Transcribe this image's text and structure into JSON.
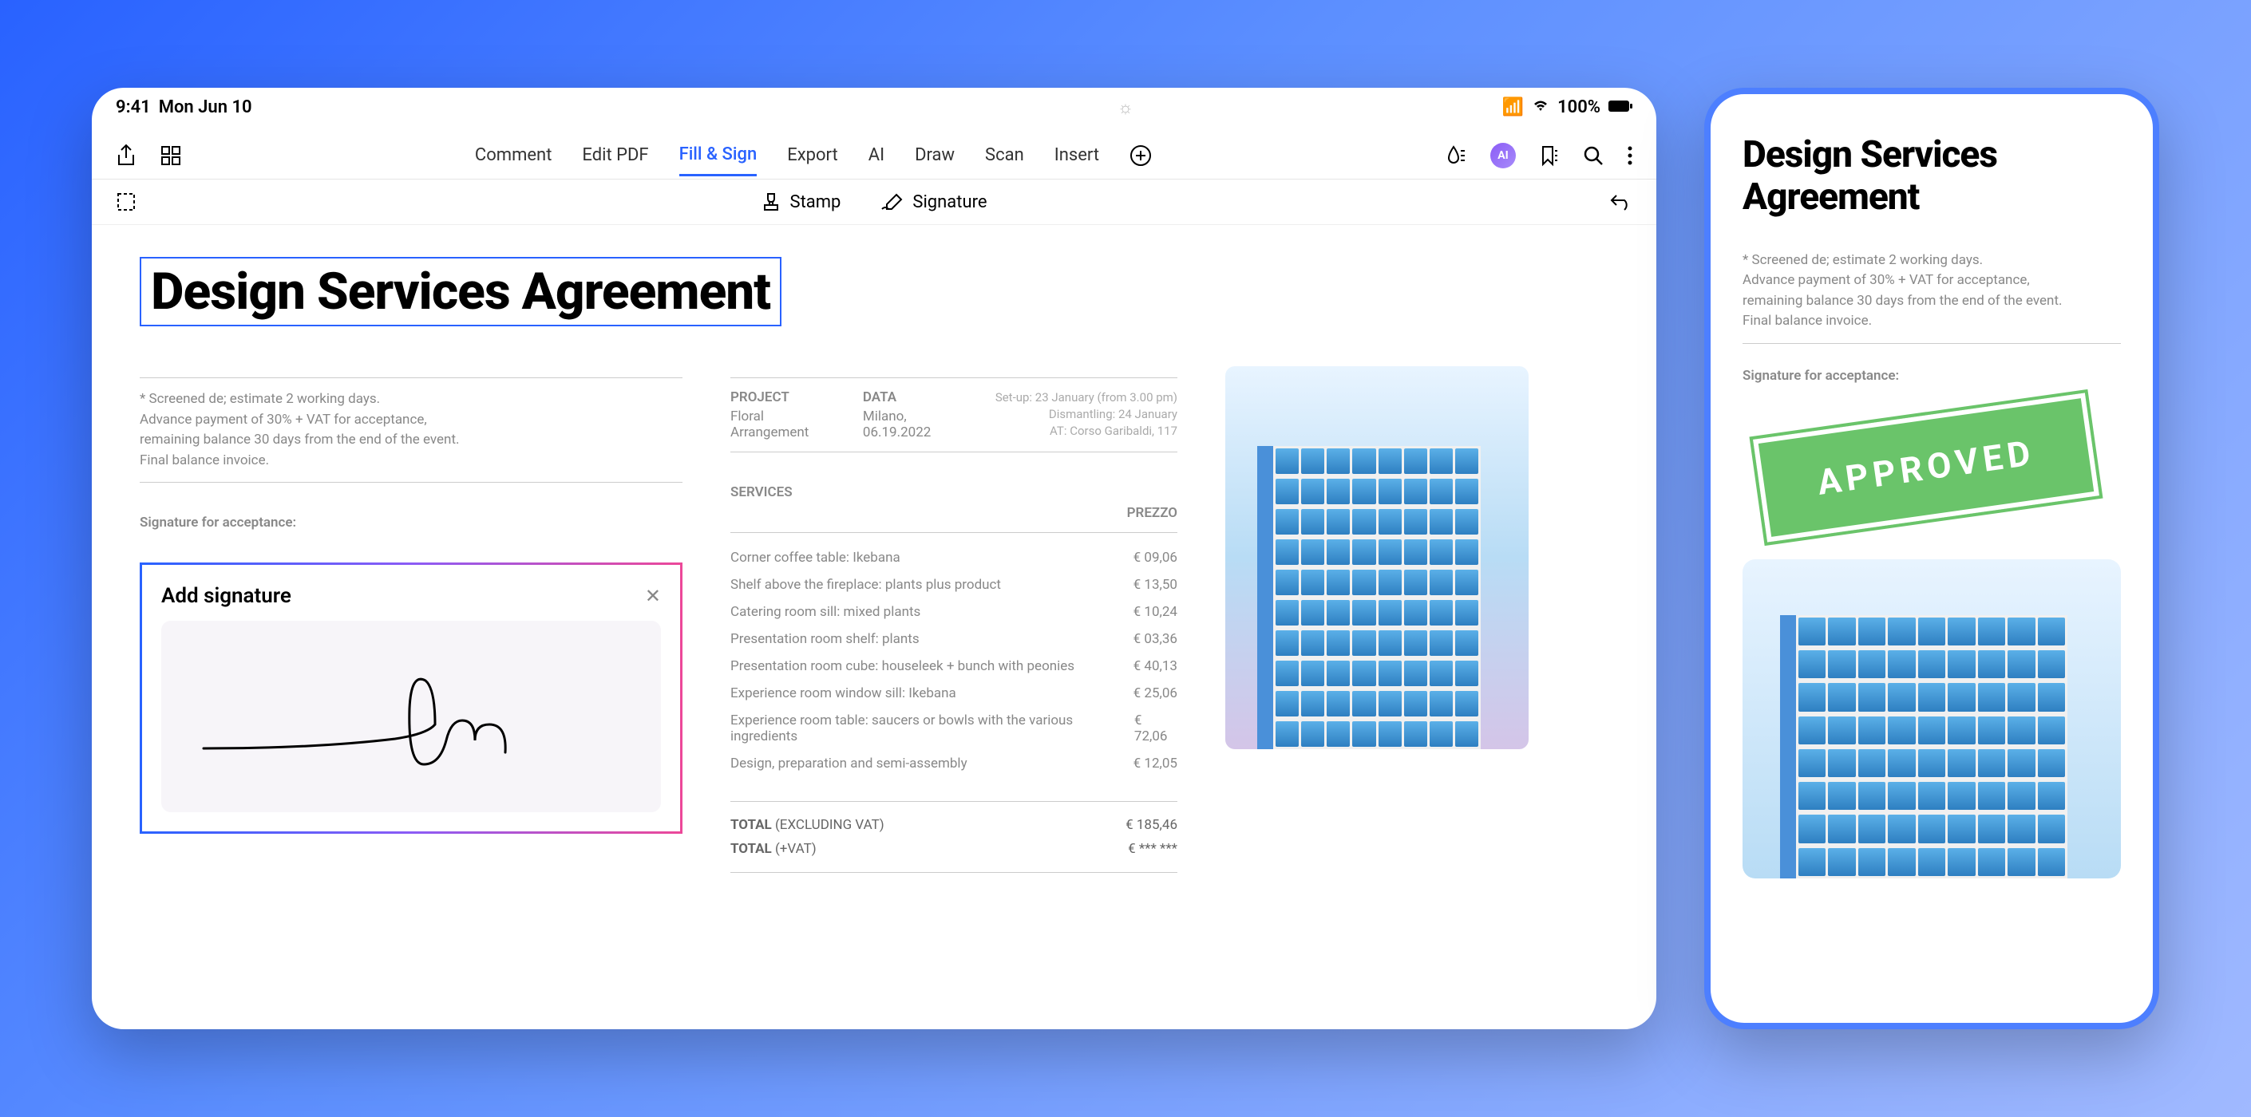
{
  "status": {
    "time": "9:41",
    "date": "Mon Jun 10",
    "battery": "100%"
  },
  "toolbar": {
    "tabs": [
      "Comment",
      "Edit PDF",
      "Fill & Sign",
      "Export",
      "AI",
      "Draw",
      "Scan",
      "Insert"
    ],
    "active_index": 2
  },
  "subtoolbar": {
    "stamp": "Stamp",
    "signature": "Signature"
  },
  "document": {
    "title": "Design Services Agreement",
    "notes": [
      "* Screened de; estimate 2 working days.",
      "Advance payment of 30% + VAT for acceptance,",
      "remaining balance 30 days from the end of the event.",
      "Final balance invoice."
    ],
    "signature_label": "Signature for acceptance:",
    "project_label": "PROJECT",
    "project_value": "Floral Arrangement",
    "data_label": "DATA",
    "data_value": "Milano, 06.19.2022",
    "meta_notes": [
      "Set-up: 23 January (from 3.00 pm)",
      "Dismantling: 24 January",
      "AT: Corso Garibaldi, 117"
    ],
    "services_label": "SERVICES",
    "price_label": "PREZZO",
    "services": [
      {
        "name": "Corner coffee table: Ikebana",
        "price": "€ 09,06"
      },
      {
        "name": "Shelf above the fireplace: plants plus product",
        "price": "€ 13,50"
      },
      {
        "name": "Catering room sill: mixed plants",
        "price": "€ 10,24"
      },
      {
        "name": "Presentation room shelf: plants",
        "price": "€ 03,36"
      },
      {
        "name": "Presentation room cube: houseleek + bunch with peonies",
        "price": "€ 40,13"
      },
      {
        "name": "Experience room window sill: Ikebana",
        "price": "€ 25,06"
      },
      {
        "name": "Experience room table: saucers or bowls with the various ingredients",
        "price": "€ 72,06"
      },
      {
        "name": "Design, preparation and semi-assembly",
        "price": "€ 12,05"
      }
    ],
    "total_ex_label": "TOTAL",
    "total_ex_paren": "(EXCLUDING VAT)",
    "total_ex_value": "€ 185,46",
    "total_vat_label": "TOTAL",
    "total_vat_paren": "(+VAT)",
    "total_vat_value": "€ *** ***"
  },
  "signature_panel": {
    "title": "Add signature"
  },
  "phone": {
    "title_line1": "Design Services",
    "title_line2": "Agreement",
    "stamp_text": "APPROVED"
  }
}
